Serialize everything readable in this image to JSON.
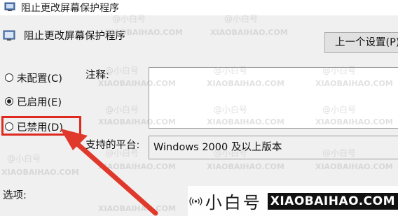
{
  "window": {
    "title": "阻止更改屏幕保护程序"
  },
  "header": {
    "policy_name": "阻止更改屏幕保护程序",
    "prev_button": "上一个设置(P)"
  },
  "options": {
    "unconfigured": "未配置(C)",
    "enabled": "已启用(E)",
    "disabled": "已禁用(D)",
    "selected": "enabled"
  },
  "comment": {
    "label": "注释:",
    "value": ""
  },
  "platform": {
    "label": "支持的平台:",
    "value": "Windows 2000 及以上版本"
  },
  "options_section": {
    "label": "选项:"
  },
  "watermark": {
    "at": "@小白号",
    "domain": "XIAOBAIHAO.COM",
    "brand_name": "小白号",
    "brand_domain": "XIAOBAIHAO.COM"
  },
  "colors": {
    "highlight": "#e02a20",
    "arrow": "#e0392c"
  }
}
